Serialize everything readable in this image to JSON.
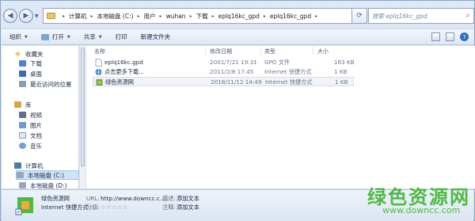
{
  "breadcrumb": [
    "计算机",
    "本地磁盘 (C:)",
    "用户",
    "wuhan",
    "下载",
    "eplq16kc_gpd",
    "eplq16kc_gpd"
  ],
  "search": {
    "placeholder": "搜索 eplq16kc_gpd"
  },
  "toolbar": {
    "organize": "组织",
    "open": "打开",
    "share": "共享",
    "print": "打印",
    "new_folder": "新建文件夹"
  },
  "sidebar": {
    "favorites": "收藏夹",
    "downloads": "下载",
    "desktop": "桌面",
    "recent": "最近访问的位置",
    "libraries": "库",
    "videos": "视频",
    "pictures": "图片",
    "documents": "文档",
    "music": "音乐",
    "computer": "计算机",
    "drive_c": "本地磁盘 (C:)",
    "drive_d": "本地磁盘 (D:)"
  },
  "columns": {
    "name": "名称",
    "date": "修改日期",
    "type": "类型",
    "size": "大小"
  },
  "files": [
    {
      "name": "eplq16kc.gpd",
      "date": "2001/7/21 19:31",
      "type": "GPD 文件",
      "size": "163 KB"
    },
    {
      "name": "点击更多下载...",
      "date": "2011/2/8 17:45",
      "type": "Internet 快捷方式",
      "size": "1 KB"
    },
    {
      "name": "绿色资源网",
      "date": "2018/11/12 14:49",
      "type": "Internet 快捷方式",
      "size": "1 KB"
    }
  ],
  "details": {
    "name": "绿色资源网",
    "type": "Internet 快捷方式",
    "url_label": "URL:",
    "url": "http://www.downcc.c...",
    "rating_label": "分级:",
    "rating_stars": "☆☆☆☆☆",
    "desc_label": "描述:",
    "desc_value": "添加文本",
    "notes_label": "注释:",
    "notes_value": "添加文本"
  },
  "watermark": {
    "text": "绿色资源网",
    "url": "www.downcc.com"
  },
  "colors": {
    "accent": "#4fb946",
    "selection": "#cfe3f7"
  }
}
